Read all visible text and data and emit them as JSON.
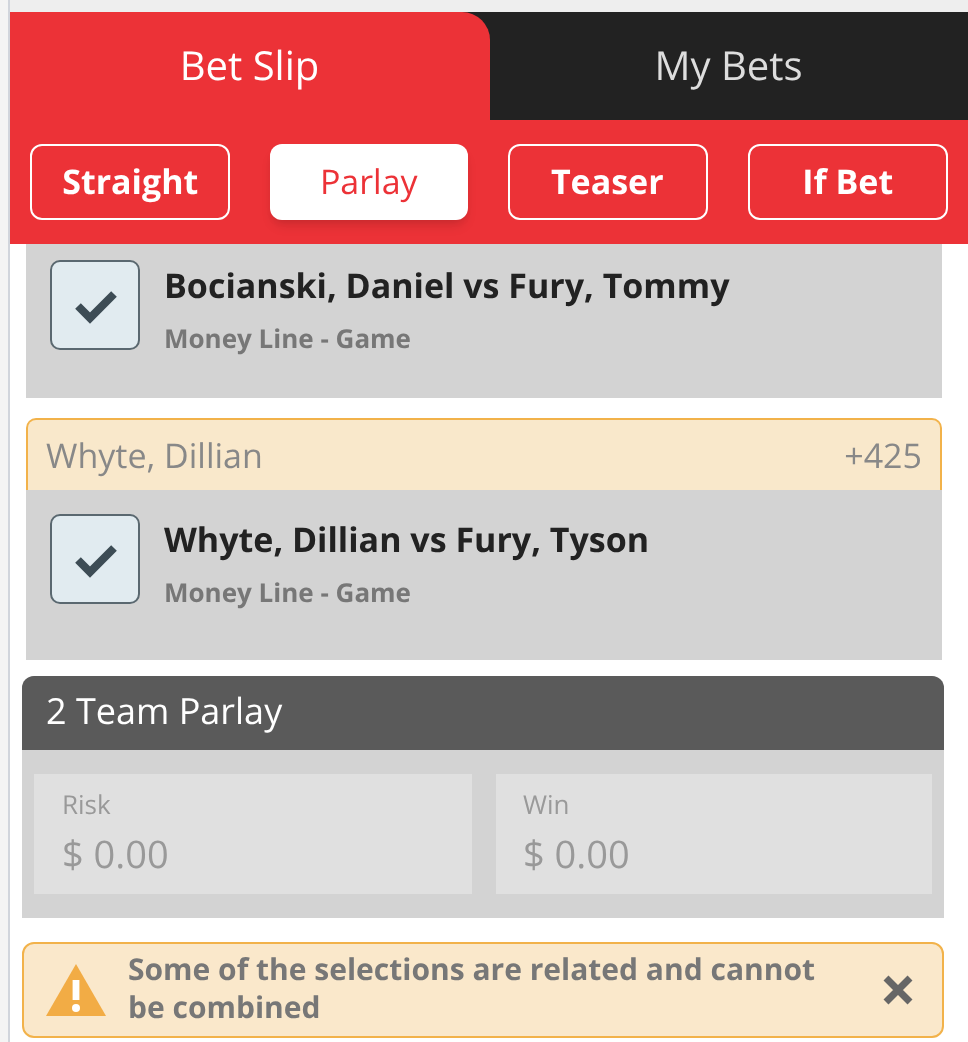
{
  "tabs": [
    {
      "label": "Bet Slip",
      "selected": true
    },
    {
      "label": "My Bets",
      "selected": false
    }
  ],
  "bet_types": [
    {
      "label": "Straight",
      "selected": false
    },
    {
      "label": "Parlay",
      "selected": true
    },
    {
      "label": "Teaser",
      "selected": false
    },
    {
      "label": "If Bet",
      "selected": false
    }
  ],
  "selections": [
    {
      "checked": true,
      "title": "Bocianski, Daniel vs Fury, Tommy",
      "subtitle": "Money Line - Game"
    },
    {
      "header": {
        "name": "Whyte, Dillian",
        "odds": "+425"
      },
      "checked": true,
      "title": "Whyte, Dillian vs Fury, Tyson",
      "subtitle": "Money Line - Game"
    }
  ],
  "parlay": {
    "title": "2 Team Parlay",
    "fields": [
      {
        "label": "Risk",
        "placeholder": "$ 0.00"
      },
      {
        "label": "Win",
        "placeholder": "$ 0.00"
      }
    ]
  },
  "warning": {
    "text": "Some of the selections are related and cannot be combined"
  }
}
